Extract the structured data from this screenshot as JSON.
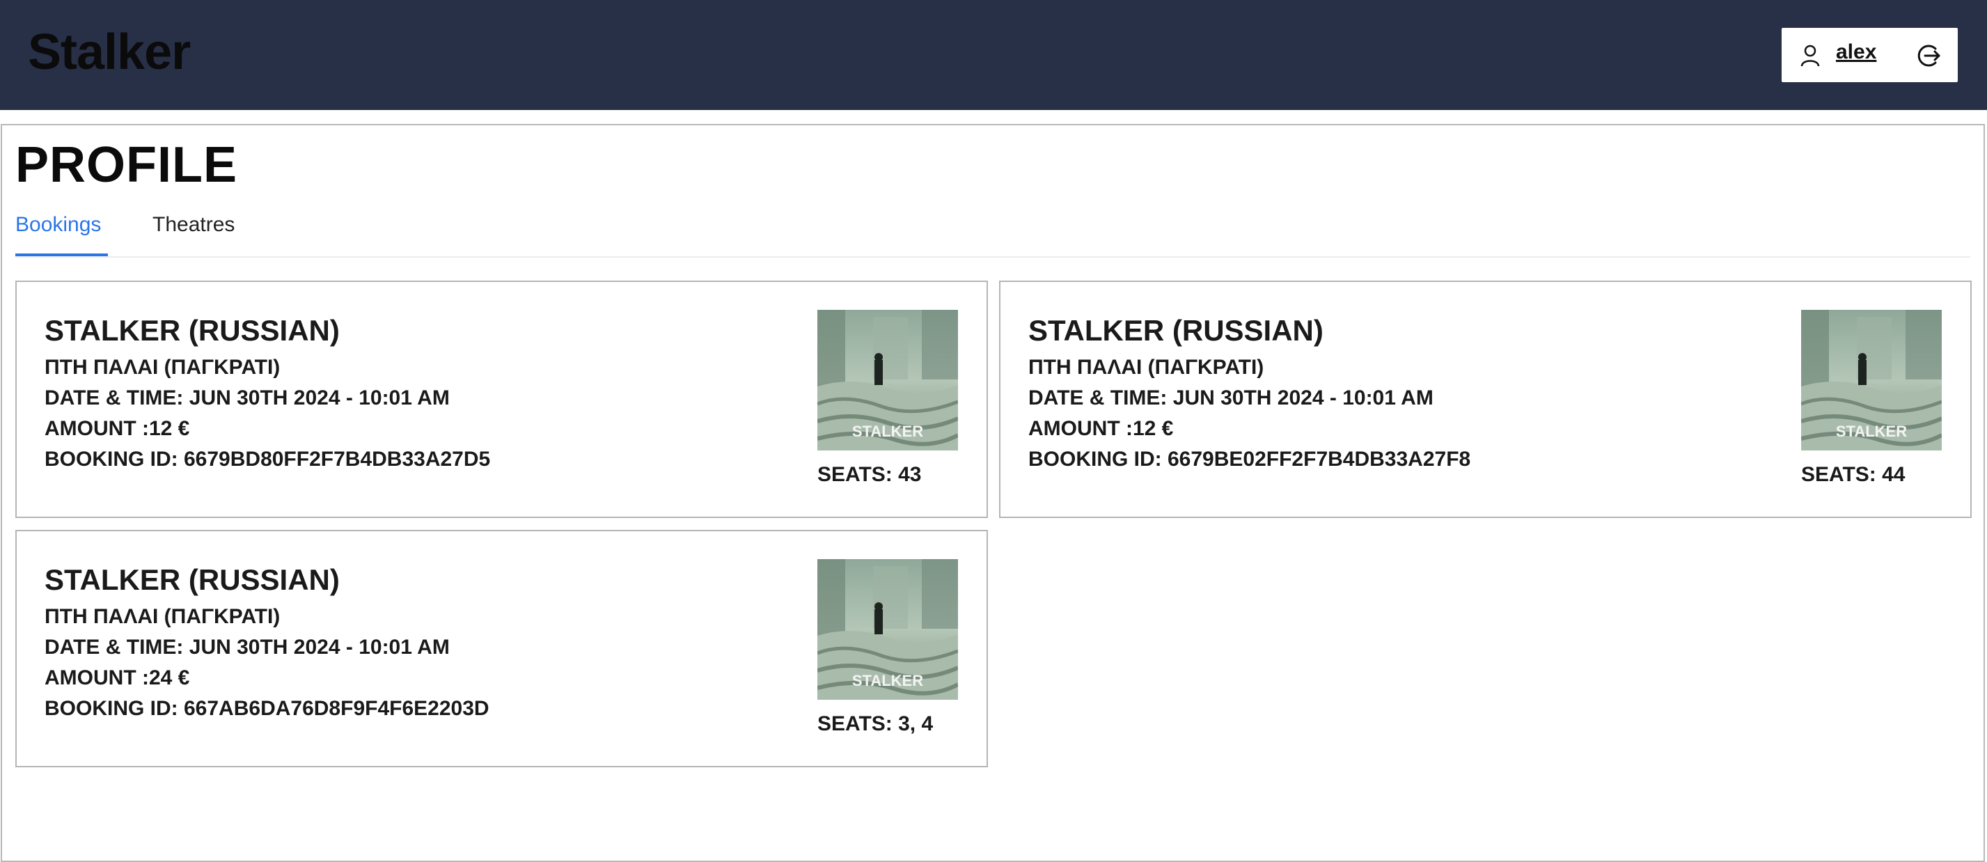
{
  "header": {
    "brand": "Stalker",
    "user": {
      "name": "alex",
      "icon": "user-icon",
      "logout_icon": "logout-icon"
    }
  },
  "page": {
    "title": "PROFILE",
    "tabs": [
      {
        "label": "Bookings",
        "active": true
      },
      {
        "label": "Theatres",
        "active": false
      }
    ]
  },
  "bookings": [
    {
      "title": "STALKER (RUSSIAN)",
      "theatre": "ΠΤΗ ΠΑΛΑΙ (ΠΑΓΚΡΑΤΙ)",
      "datetime": "DATE & TIME: JUN 30TH 2024 - 10:01 AM",
      "amount": "AMOUNT :12 €",
      "booking_id": "BOOKING ID: 6679BD80FF2F7B4DB33A27D5",
      "seats": "SEATS: 43",
      "poster_text": "STALKER"
    },
    {
      "title": "STALKER (RUSSIAN)",
      "theatre": "ΠΤΗ ΠΑΛΑΙ (ΠΑΓΚΡΑΤΙ)",
      "datetime": "DATE & TIME: JUN 30TH 2024 - 10:01 AM",
      "amount": "AMOUNT :12 €",
      "booking_id": "BOOKING ID: 6679BE02FF2F7B4DB33A27F8",
      "seats": "SEATS: 44",
      "poster_text": "STALKER"
    },
    {
      "title": "STALKER (RUSSIAN)",
      "theatre": "ΠΤΗ ΠΑΛΑΙ (ΠΑΓΚΡΑΤΙ)",
      "datetime": "DATE & TIME: JUN 30TH 2024 - 10:01 AM",
      "amount": "AMOUNT :24 €",
      "booking_id": "BOOKING ID: 667AB6DA76D8F9F4F6E2203D",
      "seats": "SEATS: 3, 4",
      "poster_text": "STALKER"
    }
  ],
  "colors": {
    "header_bg": "#283048",
    "accent": "#2a76e8",
    "card_border": "#b5b5b5"
  }
}
